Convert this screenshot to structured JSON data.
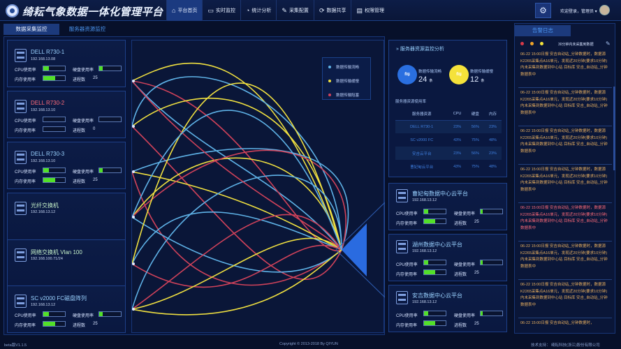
{
  "app": {
    "title": "绮耘气象数据一体化管理平台"
  },
  "nav": [
    {
      "label": "平台首页",
      "icon": "⌂"
    },
    {
      "label": "实时监控",
      "icon": "▭"
    },
    {
      "label": "统计分析",
      "icon": "◔"
    },
    {
      "label": "采集配置",
      "icon": "✎"
    },
    {
      "label": "数据共享",
      "icon": "⟳"
    },
    {
      "label": "权限管理",
      "icon": "▤"
    }
  ],
  "user": {
    "welcome": "欢迎登录，管理员 ▾"
  },
  "tabs": [
    "数据采集监控",
    "服务器资源监控"
  ],
  "labels": {
    "cpu": "CPU使用率",
    "disk": "硬盘使用率",
    "mem": "内存使用率",
    "proc": "进程数"
  },
  "servers": [
    {
      "name": "DELL R730-1",
      "ip": "192.168.13.08",
      "status": "normal",
      "cpu": 0.25,
      "disk": 0.15,
      "mem": 0.55,
      "proc": "25"
    },
    {
      "name": "DELL R730-2",
      "ip": "192.168.13.10",
      "status": "error",
      "cpu": 0,
      "disk": 0,
      "mem": 0,
      "proc": "0"
    },
    {
      "name": "DELL R730-3",
      "ip": "192.168.13.10",
      "status": "normal",
      "cpu": 0.25,
      "disk": 0.15,
      "mem": 0.55,
      "proc": "25"
    },
    {
      "name": "光纤交换机",
      "ip": "192.168.13.12",
      "status": "switch"
    },
    {
      "name": "网络交换机 Vlan 100",
      "ip": "192.168.100.71/24",
      "status": "switch"
    },
    {
      "name": "SC v2000 FC磁盘阵列",
      "ip": "192.168.13.12",
      "status": "normal",
      "cpu": 0.25,
      "disk": 0.15,
      "mem": 0.55,
      "proc": "25"
    }
  ],
  "legend": [
    {
      "label": "数据传输流畅",
      "color": "#5fb3e8"
    },
    {
      "label": "数据传输缓慢",
      "color": "#f0e040"
    },
    {
      "label": "数据传输阻塞",
      "color": "#d0425a"
    }
  ],
  "monitor": {
    "title": "服务器资源监控分析",
    "stat1": {
      "label": "数据传输流畅",
      "value": "24",
      "unit": "条",
      "color": "#2a6fe0",
      "icon": "⇋"
    },
    "stat2": {
      "label": "数据传输缓慢",
      "value": "12",
      "unit": "条",
      "color": "#f5e23a",
      "icon": "⇋"
    },
    "table_caption": "服务器资源使用率",
    "headers": [
      "服务器资源",
      "CPU",
      "硬盘",
      "内存"
    ],
    "rows": [
      [
        "DELL R730-1",
        "23%",
        "56%",
        "23%"
      ],
      [
        "SC v2000 FC",
        "43%",
        "75%",
        "48%"
      ],
      [
        "安吉云平台",
        "23%",
        "56%",
        "23%"
      ],
      [
        "曹妃甸云平台",
        "43%",
        "75%",
        "48%"
      ]
    ]
  },
  "platforms": [
    {
      "name": "曹妃甸数据中心云平台",
      "ip": "192.168.13.12",
      "cpu": 0.2,
      "disk": 0.1,
      "mem": 0.5,
      "proc": "25"
    },
    {
      "name": "湖州数据中心云平台",
      "ip": "192.168.13.12",
      "cpu": 0.2,
      "disk": 0.1,
      "mem": 0.5,
      "proc": "25"
    },
    {
      "name": "安吉数据中心云平台",
      "ip": "192.168.13.12",
      "cpu": 0.2,
      "disk": 0.1,
      "mem": 0.5,
      "proc": "25"
    }
  ],
  "alarm": {
    "title": "告警日志",
    "subtitle": "30分钟内未采集到数据",
    "dot_colors": [
      "#d83a48",
      "#f0a428",
      "#f5e23a"
    ],
    "logs": [
      {
        "text": "06-22 15:00日报 安吉自动站_分钟数据时，数据源K2265采集点A16单元，发现近20分钟(要求10分钟)内未采集到数据到中心站 目标库 安吉_自动站_分钟数据表中",
        "level": "warn"
      },
      {
        "text": "06-22 15:00日报 安吉自动站_分钟数据时，数据源K2265采集点A16单元，发现近20分钟(要求10分钟)内未采集到数据到中心站 目标库 安吉_自动站_分钟数据表中",
        "level": "warn"
      },
      {
        "text": "06-22 15:00日报 安吉自动站_分钟数据时，数据源K2265采集点A16单元，发现近20分钟(要求10分钟)内未采集到数据到中心站 目标库 安吉_自动站_分钟数据表中",
        "level": "warn"
      },
      {
        "text": "06-22 15:00日报 安吉自动站_分钟数据时，数据源K2265采集点A16单元，发现近20分钟(要求10分钟)内未采集到数据到中心站 目标库 安吉_自动站_分钟数据表中",
        "level": "warn"
      },
      {
        "text": "06-22 15:00日报 安吉自动站_分钟数据时，数据源K2265采集点A16单元，发现近20分钟(要求10分钟)内未采集到数据到中心站 目标库 安吉_自动站_分钟数据表中",
        "level": "error"
      },
      {
        "text": "06-22 15:00日报 安吉自动站_分钟数据时，数据源K2265采集点A16单元，发现近20分钟(要求10分钟)内未采集到数据到中心站 目标库 安吉_自动站_分钟数据表中",
        "level": "warn"
      },
      {
        "text": "06-22 15:00日报 安吉自动站_分钟数据时，数据源K2265采集点A16单元，发现近20分钟(要求10分钟)内未采集到数据到中心站 目标库 安吉_自动站_分钟数据表中",
        "level": "warn"
      },
      {
        "text": "06-22 15:00日报 安吉自动站_分钟数据时，",
        "level": "warn"
      }
    ]
  },
  "footer": {
    "version": "beta版V1.1.5",
    "copyright": "Copyright © 2013-2018 By QIYUN",
    "support": "技术支持：  绮耘科技(浙江)股份有限公司"
  }
}
